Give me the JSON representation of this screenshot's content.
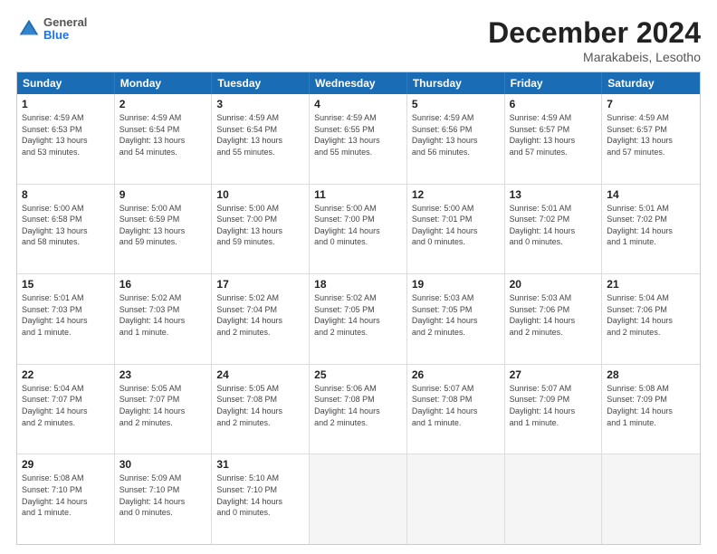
{
  "header": {
    "logo": {
      "general": "General",
      "blue": "Blue"
    },
    "title": "December 2024",
    "subtitle": "Marakabeis, Lesotho"
  },
  "days": [
    "Sunday",
    "Monday",
    "Tuesday",
    "Wednesday",
    "Thursday",
    "Friday",
    "Saturday"
  ],
  "weeks": [
    [
      {
        "day": "1",
        "text": "Sunrise: 4:59 AM\nSunset: 6:53 PM\nDaylight: 13 hours\nand 53 minutes."
      },
      {
        "day": "2",
        "text": "Sunrise: 4:59 AM\nSunset: 6:54 PM\nDaylight: 13 hours\nand 54 minutes."
      },
      {
        "day": "3",
        "text": "Sunrise: 4:59 AM\nSunset: 6:54 PM\nDaylight: 13 hours\nand 55 minutes."
      },
      {
        "day": "4",
        "text": "Sunrise: 4:59 AM\nSunset: 6:55 PM\nDaylight: 13 hours\nand 55 minutes."
      },
      {
        "day": "5",
        "text": "Sunrise: 4:59 AM\nSunset: 6:56 PM\nDaylight: 13 hours\nand 56 minutes."
      },
      {
        "day": "6",
        "text": "Sunrise: 4:59 AM\nSunset: 6:57 PM\nDaylight: 13 hours\nand 57 minutes."
      },
      {
        "day": "7",
        "text": "Sunrise: 4:59 AM\nSunset: 6:57 PM\nDaylight: 13 hours\nand 57 minutes."
      }
    ],
    [
      {
        "day": "8",
        "text": "Sunrise: 5:00 AM\nSunset: 6:58 PM\nDaylight: 13 hours\nand 58 minutes."
      },
      {
        "day": "9",
        "text": "Sunrise: 5:00 AM\nSunset: 6:59 PM\nDaylight: 13 hours\nand 59 minutes."
      },
      {
        "day": "10",
        "text": "Sunrise: 5:00 AM\nSunset: 7:00 PM\nDaylight: 13 hours\nand 59 minutes."
      },
      {
        "day": "11",
        "text": "Sunrise: 5:00 AM\nSunset: 7:00 PM\nDaylight: 14 hours\nand 0 minutes."
      },
      {
        "day": "12",
        "text": "Sunrise: 5:00 AM\nSunset: 7:01 PM\nDaylight: 14 hours\nand 0 minutes."
      },
      {
        "day": "13",
        "text": "Sunrise: 5:01 AM\nSunset: 7:02 PM\nDaylight: 14 hours\nand 0 minutes."
      },
      {
        "day": "14",
        "text": "Sunrise: 5:01 AM\nSunset: 7:02 PM\nDaylight: 14 hours\nand 1 minute."
      }
    ],
    [
      {
        "day": "15",
        "text": "Sunrise: 5:01 AM\nSunset: 7:03 PM\nDaylight: 14 hours\nand 1 minute."
      },
      {
        "day": "16",
        "text": "Sunrise: 5:02 AM\nSunset: 7:03 PM\nDaylight: 14 hours\nand 1 minute."
      },
      {
        "day": "17",
        "text": "Sunrise: 5:02 AM\nSunset: 7:04 PM\nDaylight: 14 hours\nand 2 minutes."
      },
      {
        "day": "18",
        "text": "Sunrise: 5:02 AM\nSunset: 7:05 PM\nDaylight: 14 hours\nand 2 minutes."
      },
      {
        "day": "19",
        "text": "Sunrise: 5:03 AM\nSunset: 7:05 PM\nDaylight: 14 hours\nand 2 minutes."
      },
      {
        "day": "20",
        "text": "Sunrise: 5:03 AM\nSunset: 7:06 PM\nDaylight: 14 hours\nand 2 minutes."
      },
      {
        "day": "21",
        "text": "Sunrise: 5:04 AM\nSunset: 7:06 PM\nDaylight: 14 hours\nand 2 minutes."
      }
    ],
    [
      {
        "day": "22",
        "text": "Sunrise: 5:04 AM\nSunset: 7:07 PM\nDaylight: 14 hours\nand 2 minutes."
      },
      {
        "day": "23",
        "text": "Sunrise: 5:05 AM\nSunset: 7:07 PM\nDaylight: 14 hours\nand 2 minutes."
      },
      {
        "day": "24",
        "text": "Sunrise: 5:05 AM\nSunset: 7:08 PM\nDaylight: 14 hours\nand 2 minutes."
      },
      {
        "day": "25",
        "text": "Sunrise: 5:06 AM\nSunset: 7:08 PM\nDaylight: 14 hours\nand 2 minutes."
      },
      {
        "day": "26",
        "text": "Sunrise: 5:07 AM\nSunset: 7:08 PM\nDaylight: 14 hours\nand 1 minute."
      },
      {
        "day": "27",
        "text": "Sunrise: 5:07 AM\nSunset: 7:09 PM\nDaylight: 14 hours\nand 1 minute."
      },
      {
        "day": "28",
        "text": "Sunrise: 5:08 AM\nSunset: 7:09 PM\nDaylight: 14 hours\nand 1 minute."
      }
    ],
    [
      {
        "day": "29",
        "text": "Sunrise: 5:08 AM\nSunset: 7:10 PM\nDaylight: 14 hours\nand 1 minute."
      },
      {
        "day": "30",
        "text": "Sunrise: 5:09 AM\nSunset: 7:10 PM\nDaylight: 14 hours\nand 0 minutes."
      },
      {
        "day": "31",
        "text": "Sunrise: 5:10 AM\nSunset: 7:10 PM\nDaylight: 14 hours\nand 0 minutes."
      },
      {
        "day": "",
        "text": ""
      },
      {
        "day": "",
        "text": ""
      },
      {
        "day": "",
        "text": ""
      },
      {
        "day": "",
        "text": ""
      }
    ]
  ]
}
